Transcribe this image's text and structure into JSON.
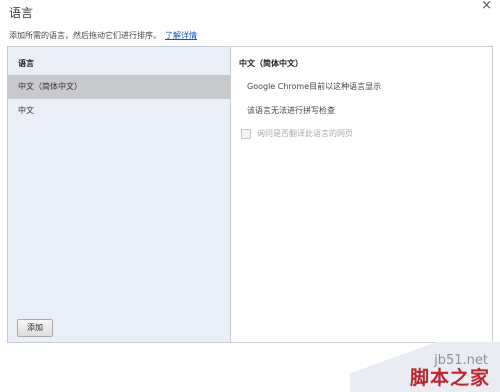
{
  "dialog": {
    "title": "语言",
    "close_glyph": "×",
    "intro": "添加所需的语言，然后拖动它们进行排序。",
    "learn_more": "了解详情"
  },
  "languages": {
    "header": "语言",
    "items": [
      {
        "label": "中文（简体中文）",
        "selected": true
      },
      {
        "label": "中文",
        "selected": false
      }
    ],
    "add_button": "添加"
  },
  "detail": {
    "title": "中文（简体中文）",
    "display_info": "Google Chrome目前以这种语言显示",
    "spellcheck_info": "该语言无法进行拼写检查",
    "translate_checkbox": "询问是否翻译此语言的网页",
    "translate_checked": false
  },
  "watermark": {
    "site": "jb51.net",
    "brand": "脚本之家"
  },
  "colors": {
    "list_background": "#eaeef7",
    "selected_row": "#c7c9cc",
    "link": "#1155cc",
    "watermark_brand": "#c4222b"
  }
}
